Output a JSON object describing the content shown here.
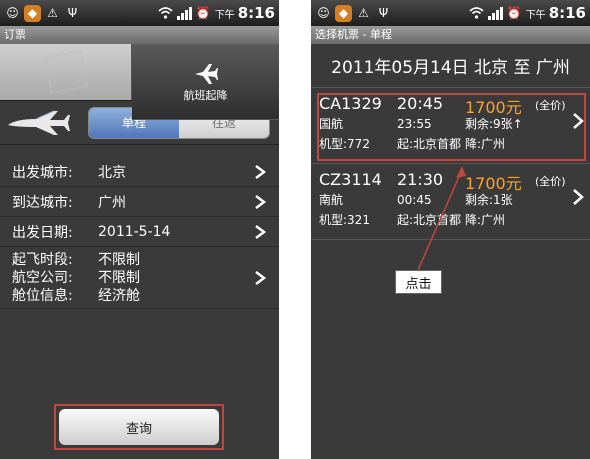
{
  "left": {
    "status": {
      "ampm": "下午",
      "time": "8:16"
    },
    "title": "订票",
    "top_icons": {
      "flight_label": "航班起降"
    },
    "trip_type": {
      "oneway": "单程",
      "roundtrip": "往返"
    },
    "fields": [
      {
        "label": "出发城市:",
        "value": "北京"
      },
      {
        "label": "到达城市:",
        "value": "广州"
      },
      {
        "label": "出发日期:",
        "value": "2011-5-14"
      }
    ],
    "options": {
      "labels": [
        "起飞时段:",
        "航空公司:",
        "舱位信息:"
      ],
      "values": [
        "不限制",
        "不限制",
        "经济舱"
      ]
    },
    "query_label": "查询"
  },
  "right": {
    "status": {
      "ampm": "下午",
      "time": "8:16"
    },
    "title": "选择机票 - 单程",
    "route": "2011年05月14日  北京 至 广州",
    "flights": [
      {
        "code": "CA1329",
        "dep": "20:45",
        "price": "1700元",
        "fare": "(全价)",
        "airline": "国航",
        "arr": "23:55",
        "seats": "剩余:9张↑",
        "model": "机型:772",
        "from": "起:北京首都",
        "to": "降:广州"
      },
      {
        "code": "CZ3114",
        "dep": "21:30",
        "price": "1700元",
        "fare": "(全价)",
        "airline": "南航",
        "arr": "00:45",
        "seats": "剩余:1张",
        "model": "机型:321",
        "from": "起:北京首都",
        "to": "降:广州"
      }
    ],
    "callout": "点击"
  },
  "colors": {
    "highlight": "#c0473c",
    "price": "#ffa126",
    "segment_active": "#4f78b8"
  },
  "icons": [
    "system-icon",
    "app-hex-icon",
    "warning-icon",
    "usb-icon",
    "wifi-icon",
    "signal-icon",
    "alarm-icon",
    "airplane-icon",
    "chevron-right-icon"
  ]
}
